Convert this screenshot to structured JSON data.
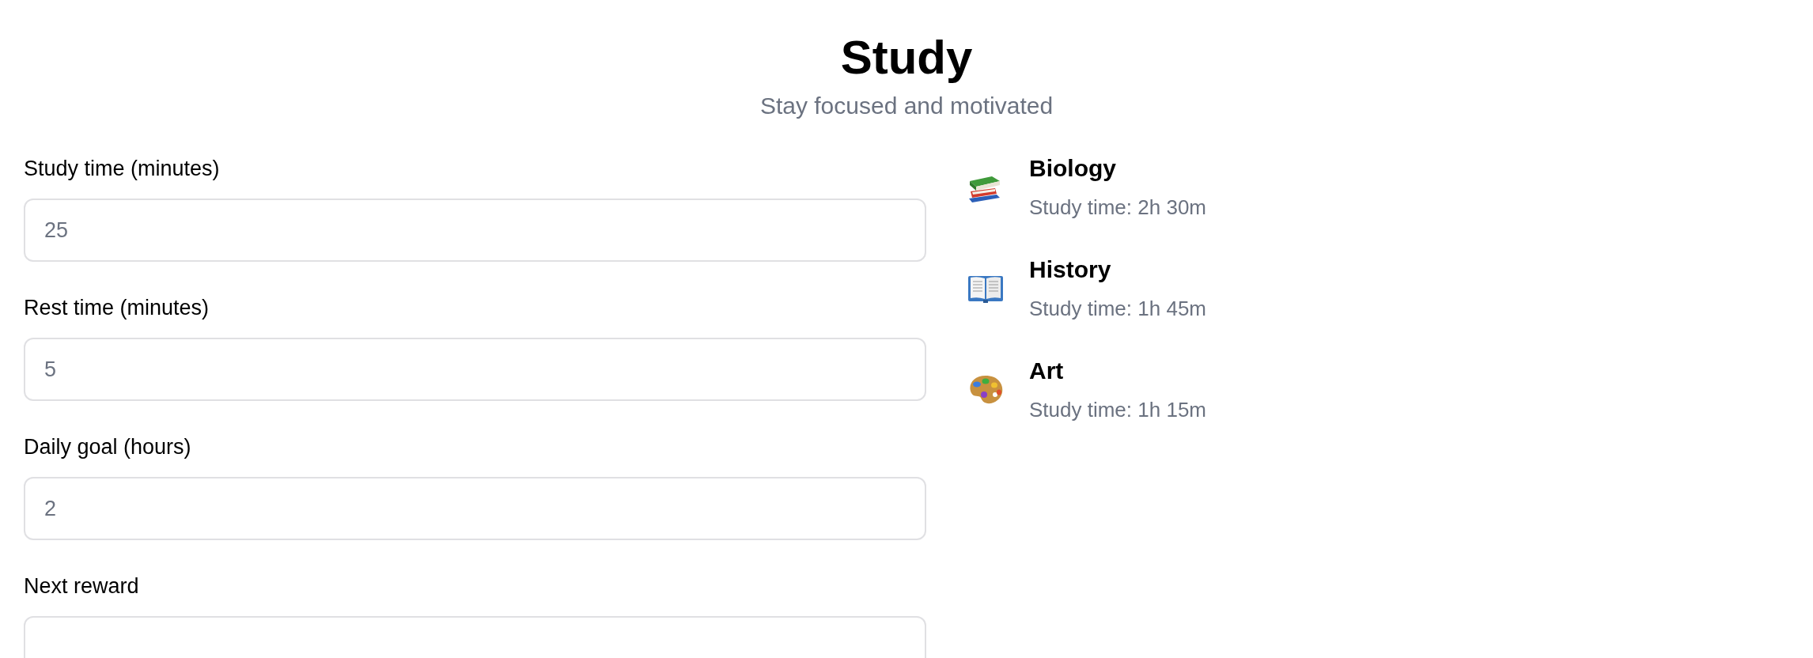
{
  "header": {
    "title": "Study",
    "subtitle": "Stay focused and motivated"
  },
  "fields": [
    {
      "label": "Study time (minutes)",
      "placeholder": "25"
    },
    {
      "label": "Rest time (minutes)",
      "placeholder": "5"
    },
    {
      "label": "Daily goal (hours)",
      "placeholder": "2"
    },
    {
      "label": "Next reward"
    }
  ],
  "subjects": [
    {
      "kind": "books",
      "name": "Biology",
      "time": "Study time: 2h 30m"
    },
    {
      "kind": "book",
      "name": "History",
      "time": "Study time: 1h 45m"
    },
    {
      "kind": "palette",
      "name": "Art",
      "time": "Study time: 1h 15m"
    }
  ]
}
